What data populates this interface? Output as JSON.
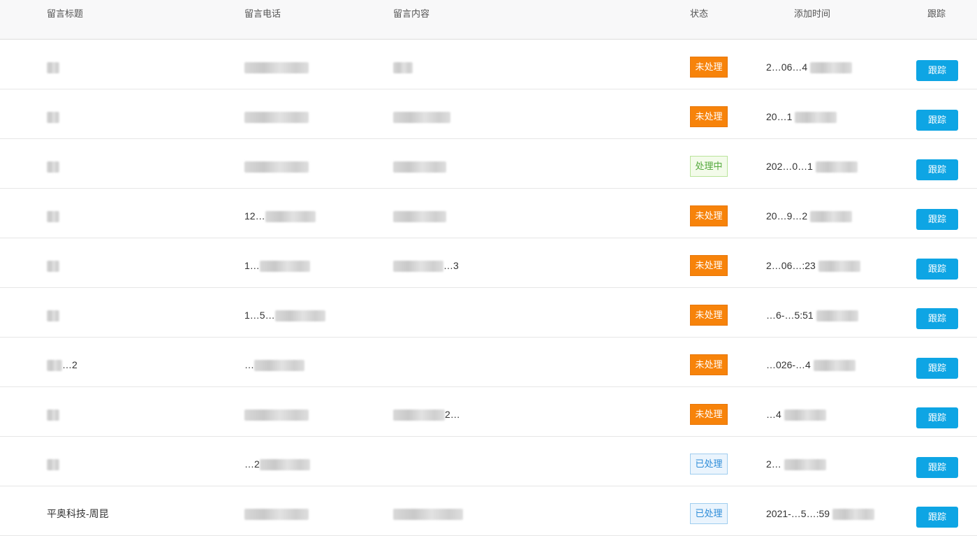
{
  "header": {
    "columns": [
      "留言标题",
      "留言电话",
      "留言内容",
      "状态",
      "添加时间",
      "跟踪"
    ]
  },
  "colors": {
    "pending": "#f7830a",
    "processing": "#52a83b",
    "done": "#2d8cd8",
    "action": "#0ea5e4"
  },
  "rows": [
    {
      "title_visible": "",
      "phone_visible": "",
      "content_visible": "",
      "status": "未处理",
      "status_type": "pending",
      "time_visible": "2…06…4",
      "action": "跟踪"
    },
    {
      "title_visible": "",
      "phone_visible": "",
      "content_visible": "",
      "status": "未处理",
      "status_type": "pending",
      "time_visible": "20…1",
      "action": "跟踪"
    },
    {
      "title_visible": "",
      "phone_visible": "",
      "content_visible": "",
      "status": "处理中",
      "status_type": "processing",
      "time_visible": "202…0…1",
      "action": "跟踪"
    },
    {
      "title_visible": "",
      "phone_visible": "12…",
      "content_visible": "",
      "status": "未处理",
      "status_type": "pending",
      "time_visible": "20…9…2",
      "action": "跟踪"
    },
    {
      "title_visible": "",
      "phone_visible": "1…",
      "content_visible": "…3",
      "status": "未处理",
      "status_type": "pending",
      "time_visible": "2…06…:23",
      "action": "跟踪"
    },
    {
      "title_visible": "",
      "phone_visible": "1…5…",
      "content_visible": "",
      "status": "未处理",
      "status_type": "pending",
      "time_visible": "…6-…5:51",
      "action": "跟踪"
    },
    {
      "title_visible": "…2",
      "phone_visible": "…",
      "content_visible": "",
      "status": "未处理",
      "status_type": "pending",
      "time_visible": "…026-…4",
      "action": "跟踪"
    },
    {
      "title_visible": "",
      "phone_visible": "",
      "content_visible": "2…",
      "status": "未处理",
      "status_type": "pending",
      "time_visible": "…4",
      "action": "跟踪"
    },
    {
      "title_visible": "",
      "phone_visible": "…2",
      "content_visible": "",
      "status": "已处理",
      "status_type": "done",
      "time_visible": "2…",
      "action": "跟踪"
    },
    {
      "title_visible": "平奥科技-周昆",
      "phone_visible": "",
      "content_visible": "",
      "status": "已处理",
      "status_type": "done",
      "time_visible": "2021-…5…:59",
      "action": "跟踪"
    }
  ]
}
